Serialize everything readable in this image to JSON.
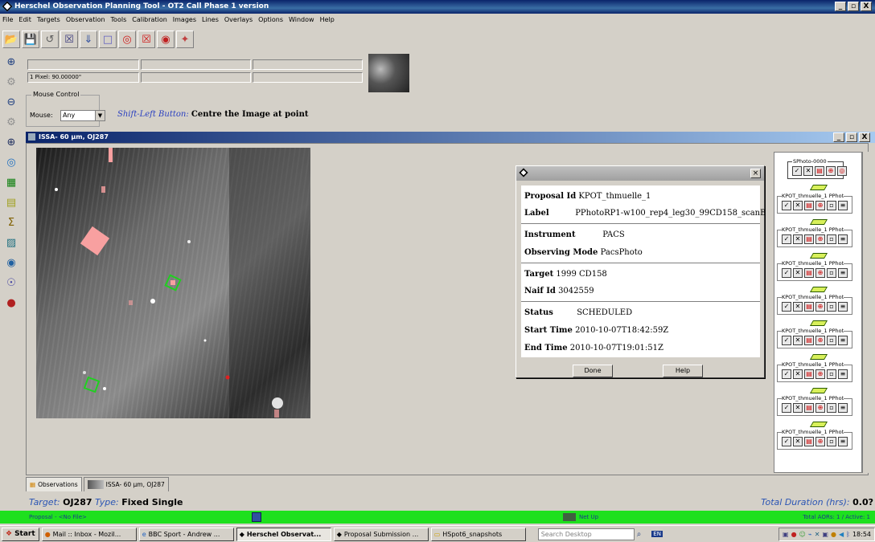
{
  "app": {
    "title": "Herschel Observation Planning Tool - OT2 Call Phase 1 version",
    "window_buttons": [
      "_",
      "×",
      "X"
    ]
  },
  "menu": [
    "File",
    "Edit",
    "Targets",
    "Observation",
    "Tools",
    "Calibration",
    "Images",
    "Lines",
    "Overlays",
    "Options",
    "Window",
    "Help"
  ],
  "coords": {
    "pixel_label": "1 Pixel: 90.00000\""
  },
  "mouse_control": {
    "legend": "Mouse Control",
    "mouse_label": "Mouse:",
    "mouse_value": "Any",
    "hint_italic": "Shift-Left Button:",
    "hint_bold": "Centre the Image at point"
  },
  "image_window": {
    "title": "ISSA- 60 μm,  OJ287"
  },
  "dialog": {
    "proposal_id_key": "Proposal Id",
    "proposal_id_value": "KPOT_thmuelle_1",
    "label_key": "Label",
    "label_value": "PPhotoRP1-w100_rep4_leg30_99CD158_scanB",
    "instrument_key": "Instrument",
    "instrument_value": "PACS",
    "obs_mode_key": "Observing Mode",
    "obs_mode_value": "PacsPhoto",
    "target_key": "Target",
    "target_value": "1999 CD158",
    "naif_key": "Naif Id",
    "naif_value": "3042559",
    "status_key": "Status",
    "status_value": "SCHEDULED",
    "start_key": "Start Time",
    "start_value": "2010-10-07T18:42:59Z",
    "end_key": "End Time",
    "end_value": "2010-10-07T19:01:51Z",
    "done_label": "Done",
    "help_label": "Help"
  },
  "right_panel": {
    "first_label": "SPhoto-0000",
    "item_label": "KPOT_thmuelle_1 PPhot"
  },
  "tabs": [
    {
      "label": "Observations"
    },
    {
      "label": "ISSA- 60 μm,  OJ287"
    }
  ],
  "target_line": {
    "target_key": "Target:",
    "target_value": "OJ287",
    "type_key": "Type:",
    "type_value": "Fixed Single",
    "duration_key": "Total Duration (hrs):",
    "duration_value": "0.0?"
  },
  "status_bar": {
    "proposal": "Proposal - <No File>",
    "net": "Net Up",
    "aors": "Total AORs: 1 / Active: 1"
  },
  "taskbar": {
    "start": "Start",
    "items": [
      "Mail :: Inbox - Mozil...",
      "BBC Sport - Andrew ...",
      "Herschel Observat...",
      "Proposal Submission ...",
      "HSpot6_snapshots"
    ],
    "search_placeholder": "Search Desktop",
    "lang": "EN",
    "clock": "18:54"
  }
}
